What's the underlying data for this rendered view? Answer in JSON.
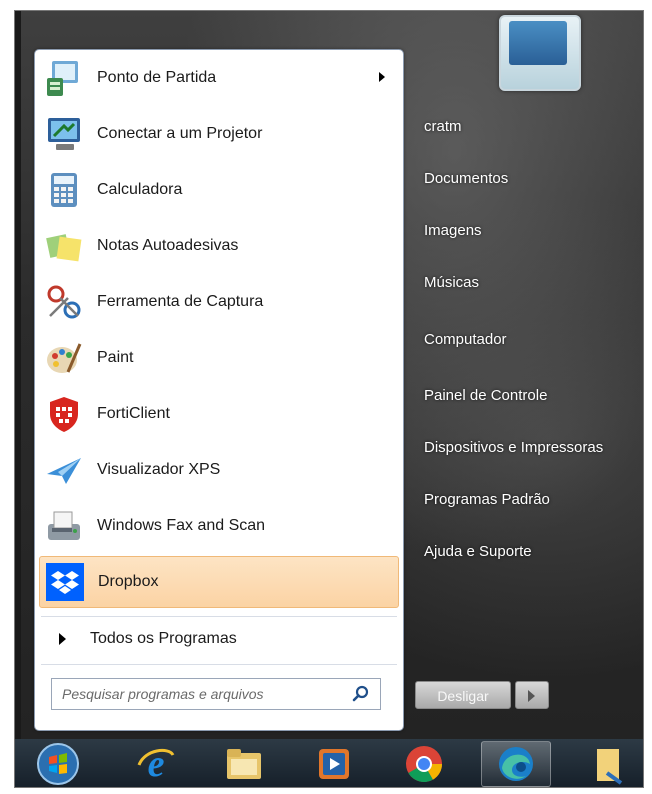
{
  "start_menu": {
    "programs": [
      {
        "label": "Ponto de Partida",
        "icon": "getting-started-icon",
        "has_submenu": true
      },
      {
        "label": "Conectar a um Projetor",
        "icon": "projector-icon"
      },
      {
        "label": "Calculadora",
        "icon": "calculator-icon"
      },
      {
        "label": "Notas Autoadesivas",
        "icon": "sticky-notes-icon"
      },
      {
        "label": "Ferramenta de Captura",
        "icon": "snipping-tool-icon"
      },
      {
        "label": "Paint",
        "icon": "paint-icon"
      },
      {
        "label": "FortiClient",
        "icon": "forticlient-icon"
      },
      {
        "label": "Visualizador XPS",
        "icon": "xps-viewer-icon"
      },
      {
        "label": "Windows Fax and Scan",
        "icon": "fax-scan-icon"
      },
      {
        "label": "Dropbox",
        "icon": "dropbox-icon",
        "highlighted": true
      }
    ],
    "all_programs_label": "Todos os Programas",
    "search_placeholder": "Pesquisar programas e arquivos",
    "right_links": [
      "cratm",
      "Documentos",
      "Imagens",
      "Músicas",
      "Computador",
      "Painel de Controle",
      "Dispositivos e Impressoras",
      "Programas Padrão",
      "Ajuda e Suporte"
    ],
    "shutdown_label": "Desligar"
  },
  "taskbar": {
    "items": [
      "start-orb-icon",
      "internet-explorer-icon",
      "file-explorer-icon",
      "media-player-icon",
      "chrome-icon",
      "edge-icon",
      "folder-icon"
    ]
  },
  "colors": {
    "highlight": "#fbd3a4",
    "dropbox_blue": "#0061fe",
    "taskbar": "#16202a"
  }
}
